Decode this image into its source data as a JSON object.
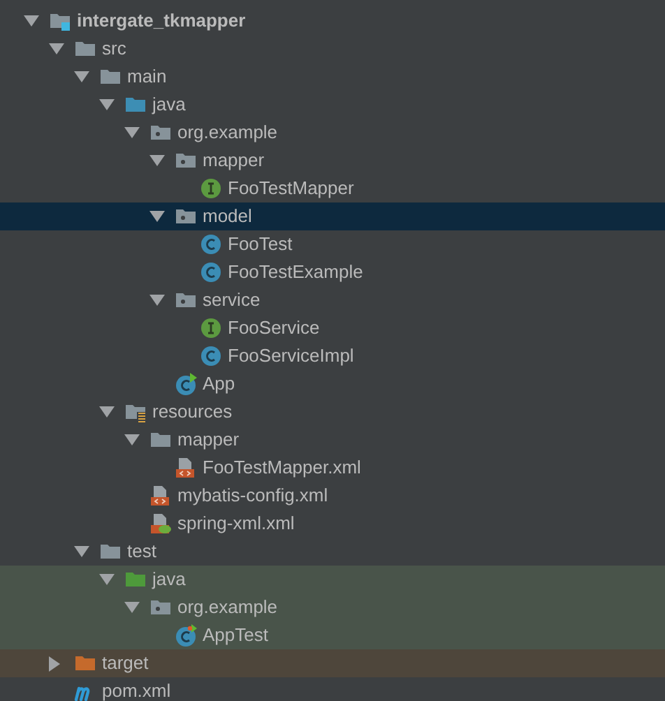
{
  "tree": [
    {
      "name": "intergate_tkmapper",
      "kind": "module",
      "expanded": true,
      "selected": false,
      "children": [
        {
          "name": "src",
          "kind": "folder",
          "expanded": true,
          "selected": false,
          "children": [
            {
              "name": "main",
              "kind": "folder",
              "expanded": true,
              "selected": false,
              "children": [
                {
                  "name": "java",
                  "kind": "source-folder",
                  "expanded": true,
                  "selected": false,
                  "children": [
                    {
                      "name": "org.example",
                      "kind": "package",
                      "expanded": true,
                      "selected": false,
                      "children": [
                        {
                          "name": "mapper",
                          "kind": "package",
                          "expanded": true,
                          "selected": false,
                          "children": [
                            {
                              "name": "FooTestMapper",
                              "kind": "interface",
                              "selected": false
                            }
                          ]
                        },
                        {
                          "name": "model",
                          "kind": "package",
                          "expanded": true,
                          "selected": true,
                          "children": [
                            {
                              "name": "FooTest",
                              "kind": "class",
                              "selected": false
                            },
                            {
                              "name": "FooTestExample",
                              "kind": "class",
                              "selected": false
                            }
                          ]
                        },
                        {
                          "name": "service",
                          "kind": "package",
                          "expanded": true,
                          "selected": false,
                          "children": [
                            {
                              "name": "FooService",
                              "kind": "interface",
                              "selected": false
                            },
                            {
                              "name": "FooServiceImpl",
                              "kind": "class",
                              "selected": false
                            }
                          ]
                        },
                        {
                          "name": "App",
                          "kind": "runnable-class",
                          "selected": false
                        }
                      ]
                    }
                  ]
                },
                {
                  "name": "resources",
                  "kind": "resource-folder",
                  "expanded": true,
                  "selected": false,
                  "children": [
                    {
                      "name": "mapper",
                      "kind": "folder",
                      "expanded": true,
                      "selected": false,
                      "children": [
                        {
                          "name": "FooTestMapper.xml",
                          "kind": "xml",
                          "selected": false
                        }
                      ]
                    },
                    {
                      "name": "mybatis-config.xml",
                      "kind": "xml",
                      "selected": false
                    },
                    {
                      "name": "spring-xml.xml",
                      "kind": "spring-xml",
                      "selected": false
                    }
                  ]
                }
              ]
            },
            {
              "name": "test",
              "kind": "folder",
              "expanded": true,
              "selected": false,
              "children": [
                {
                  "name": "java",
                  "kind": "test-folder",
                  "expanded": true,
                  "selected": false,
                  "color": "#49544a",
                  "children": [
                    {
                      "name": "org.example",
                      "kind": "package",
                      "expanded": true,
                      "selected": false,
                      "color": "#49544a",
                      "children": [
                        {
                          "name": "AppTest",
                          "kind": "test-class",
                          "selected": false,
                          "color": "#49544a"
                        }
                      ]
                    }
                  ]
                }
              ]
            }
          ]
        },
        {
          "name": "target",
          "kind": "excluded-folder",
          "expanded": false,
          "selected": false,
          "color": "#4e463b"
        },
        {
          "name": "pom.xml",
          "kind": "maven",
          "selected": false
        }
      ]
    }
  ]
}
